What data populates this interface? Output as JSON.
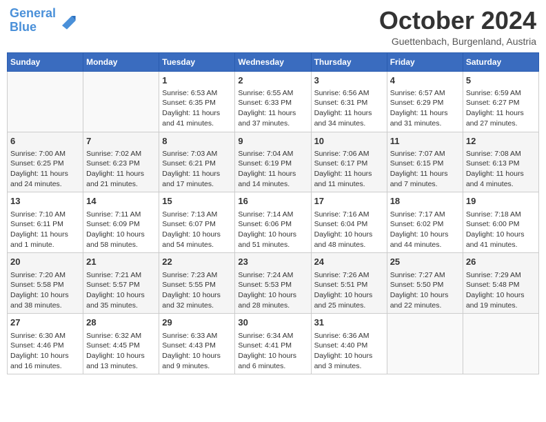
{
  "header": {
    "logo_general": "General",
    "logo_blue": "Blue",
    "month": "October 2024",
    "location": "Guettenbach, Burgenland, Austria"
  },
  "days_of_week": [
    "Sunday",
    "Monday",
    "Tuesday",
    "Wednesday",
    "Thursday",
    "Friday",
    "Saturday"
  ],
  "weeks": [
    [
      {
        "day": "",
        "content": ""
      },
      {
        "day": "",
        "content": ""
      },
      {
        "day": "1",
        "content": "Sunrise: 6:53 AM\nSunset: 6:35 PM\nDaylight: 11 hours and 41 minutes."
      },
      {
        "day": "2",
        "content": "Sunrise: 6:55 AM\nSunset: 6:33 PM\nDaylight: 11 hours and 37 minutes."
      },
      {
        "day": "3",
        "content": "Sunrise: 6:56 AM\nSunset: 6:31 PM\nDaylight: 11 hours and 34 minutes."
      },
      {
        "day": "4",
        "content": "Sunrise: 6:57 AM\nSunset: 6:29 PM\nDaylight: 11 hours and 31 minutes."
      },
      {
        "day": "5",
        "content": "Sunrise: 6:59 AM\nSunset: 6:27 PM\nDaylight: 11 hours and 27 minutes."
      }
    ],
    [
      {
        "day": "6",
        "content": "Sunrise: 7:00 AM\nSunset: 6:25 PM\nDaylight: 11 hours and 24 minutes."
      },
      {
        "day": "7",
        "content": "Sunrise: 7:02 AM\nSunset: 6:23 PM\nDaylight: 11 hours and 21 minutes."
      },
      {
        "day": "8",
        "content": "Sunrise: 7:03 AM\nSunset: 6:21 PM\nDaylight: 11 hours and 17 minutes."
      },
      {
        "day": "9",
        "content": "Sunrise: 7:04 AM\nSunset: 6:19 PM\nDaylight: 11 hours and 14 minutes."
      },
      {
        "day": "10",
        "content": "Sunrise: 7:06 AM\nSunset: 6:17 PM\nDaylight: 11 hours and 11 minutes."
      },
      {
        "day": "11",
        "content": "Sunrise: 7:07 AM\nSunset: 6:15 PM\nDaylight: 11 hours and 7 minutes."
      },
      {
        "day": "12",
        "content": "Sunrise: 7:08 AM\nSunset: 6:13 PM\nDaylight: 11 hours and 4 minutes."
      }
    ],
    [
      {
        "day": "13",
        "content": "Sunrise: 7:10 AM\nSunset: 6:11 PM\nDaylight: 11 hours and 1 minute."
      },
      {
        "day": "14",
        "content": "Sunrise: 7:11 AM\nSunset: 6:09 PM\nDaylight: 10 hours and 58 minutes."
      },
      {
        "day": "15",
        "content": "Sunrise: 7:13 AM\nSunset: 6:07 PM\nDaylight: 10 hours and 54 minutes."
      },
      {
        "day": "16",
        "content": "Sunrise: 7:14 AM\nSunset: 6:06 PM\nDaylight: 10 hours and 51 minutes."
      },
      {
        "day": "17",
        "content": "Sunrise: 7:16 AM\nSunset: 6:04 PM\nDaylight: 10 hours and 48 minutes."
      },
      {
        "day": "18",
        "content": "Sunrise: 7:17 AM\nSunset: 6:02 PM\nDaylight: 10 hours and 44 minutes."
      },
      {
        "day": "19",
        "content": "Sunrise: 7:18 AM\nSunset: 6:00 PM\nDaylight: 10 hours and 41 minutes."
      }
    ],
    [
      {
        "day": "20",
        "content": "Sunrise: 7:20 AM\nSunset: 5:58 PM\nDaylight: 10 hours and 38 minutes."
      },
      {
        "day": "21",
        "content": "Sunrise: 7:21 AM\nSunset: 5:57 PM\nDaylight: 10 hours and 35 minutes."
      },
      {
        "day": "22",
        "content": "Sunrise: 7:23 AM\nSunset: 5:55 PM\nDaylight: 10 hours and 32 minutes."
      },
      {
        "day": "23",
        "content": "Sunrise: 7:24 AM\nSunset: 5:53 PM\nDaylight: 10 hours and 28 minutes."
      },
      {
        "day": "24",
        "content": "Sunrise: 7:26 AM\nSunset: 5:51 PM\nDaylight: 10 hours and 25 minutes."
      },
      {
        "day": "25",
        "content": "Sunrise: 7:27 AM\nSunset: 5:50 PM\nDaylight: 10 hours and 22 minutes."
      },
      {
        "day": "26",
        "content": "Sunrise: 7:29 AM\nSunset: 5:48 PM\nDaylight: 10 hours and 19 minutes."
      }
    ],
    [
      {
        "day": "27",
        "content": "Sunrise: 6:30 AM\nSunset: 4:46 PM\nDaylight: 10 hours and 16 minutes."
      },
      {
        "day": "28",
        "content": "Sunrise: 6:32 AM\nSunset: 4:45 PM\nDaylight: 10 hours and 13 minutes."
      },
      {
        "day": "29",
        "content": "Sunrise: 6:33 AM\nSunset: 4:43 PM\nDaylight: 10 hours and 9 minutes."
      },
      {
        "day": "30",
        "content": "Sunrise: 6:34 AM\nSunset: 4:41 PM\nDaylight: 10 hours and 6 minutes."
      },
      {
        "day": "31",
        "content": "Sunrise: 6:36 AM\nSunset: 4:40 PM\nDaylight: 10 hours and 3 minutes."
      },
      {
        "day": "",
        "content": ""
      },
      {
        "day": "",
        "content": ""
      }
    ]
  ]
}
